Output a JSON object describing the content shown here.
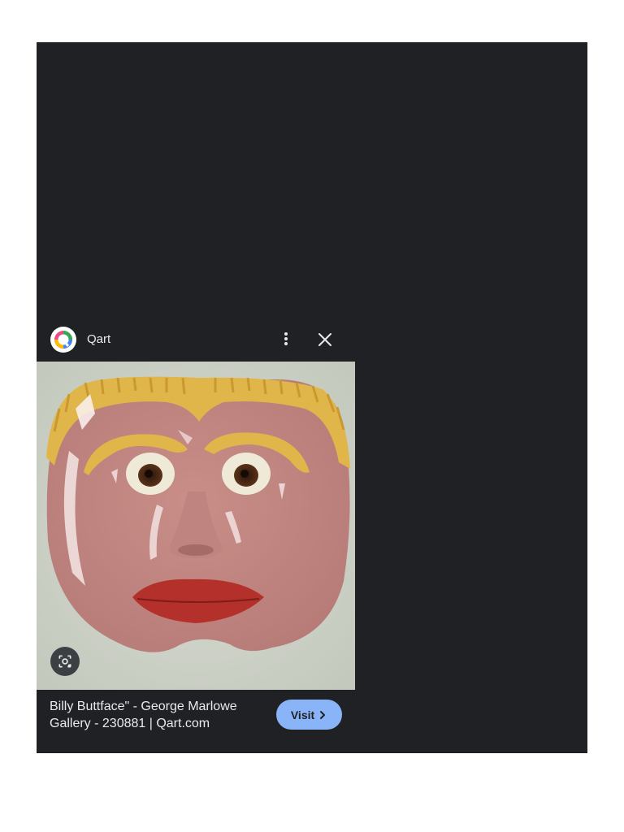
{
  "panel": {
    "site_name": "Qart",
    "caption": "Billy Buttface\" - George Marlowe Gallery - 230881 | Qart.com",
    "visit_label": "Visit"
  },
  "icons": {
    "logo": "qart-logo-icon",
    "more": "more-vert-icon",
    "close": "close-icon",
    "lens": "lens-search-icon",
    "visit_arrow": "chevron-right-icon"
  },
  "colors": {
    "background": "#202124",
    "text": "#e8eaed",
    "accent": "#8ab4f8"
  }
}
